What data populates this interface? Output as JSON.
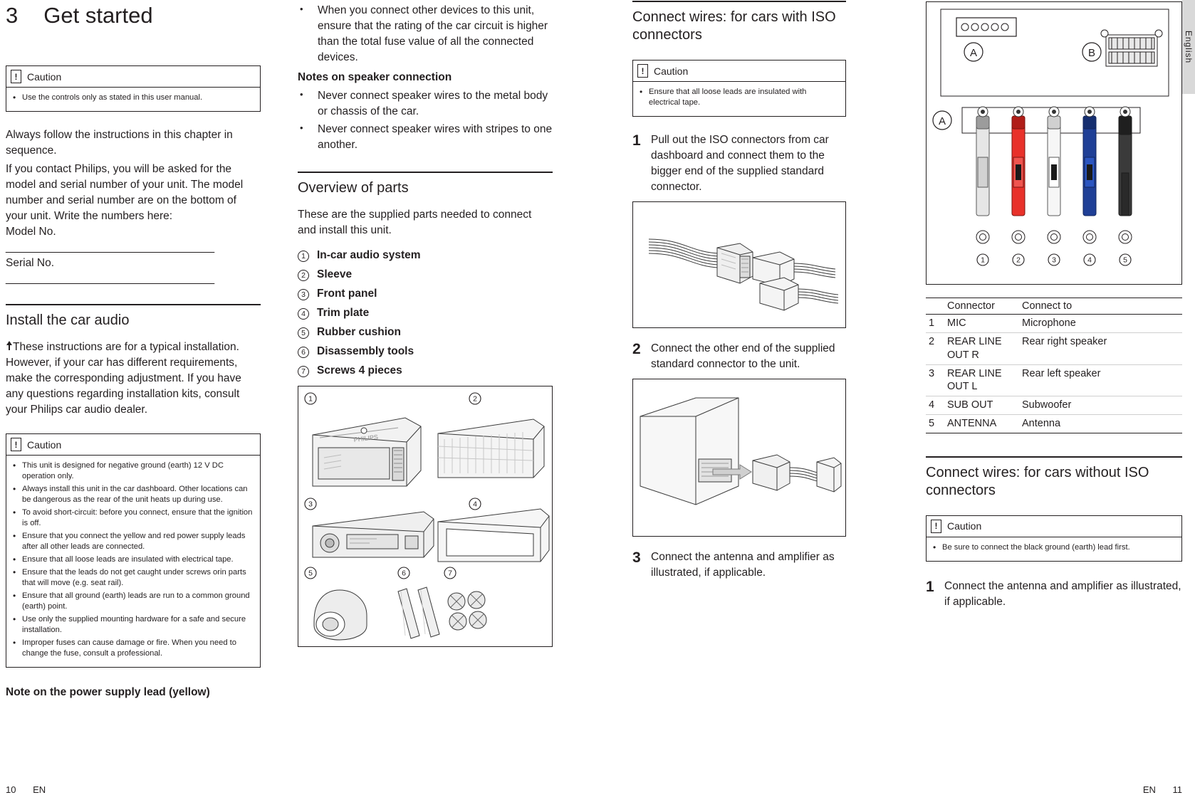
{
  "document": {
    "language_tab": "English",
    "footer_left_page": "10",
    "footer_left_lang": "EN",
    "footer_right_lang": "EN",
    "footer_right_page": "11"
  },
  "chapter": {
    "number": "3",
    "title": "Get started"
  },
  "col1": {
    "caution1": {
      "title": "Caution",
      "items": [
        "Use the controls only as stated in this user manual."
      ]
    },
    "intro_paragraphs": [
      "Always follow the instructions in this chapter in sequence.",
      "If you contact Philips, you will be asked for the model and serial number of your unit. The model number and serial number are on the bottom of your unit. Write the numbers here:",
      "Model No. __________________________________",
      "Serial No. __________________________________"
    ],
    "section_title": "Install the car audio",
    "note_paragraph": "These instructions are for a typical installation. However, if your car has different requirements, make the corresponding adjustment. If you have any questions regarding installation kits, consult your Philips car audio dealer.",
    "caution2": {
      "title": "Caution",
      "items": [
        "This unit is designed for negative ground (earth) 12 V DC operation only.",
        "Always install this unit in the car dashboard. Other locations can be dangerous as the rear of the unit heats up during use.",
        "To avoid short-circuit: before you connect, ensure that the ignition is off.",
        "Ensure that you connect the yellow and red power supply leads after all other leads are connected.",
        "Ensure that all loose leads are insulated with electrical tape.",
        "Ensure that the leads do not get caught under screws orin parts that will move (e.g. seat rail).",
        "Ensure that all ground (earth) leads are run to a common ground (earth) point.",
        "Use only the supplied mounting hardware for a safe and secure installation.",
        "Improper fuses can cause damage or fire. When you need to change the fuse, consult a professional."
      ]
    },
    "note_power_supply": "Note on the power supply lead (yellow)"
  },
  "col2": {
    "top_bullets": [
      "When you connect other devices to this unit, ensure that the rating of the car circuit is higher than the total fuse value of all the connected devices."
    ],
    "notes_heading": "Notes on speaker connection",
    "notes_bullets": [
      "Never connect speaker wires to the metal body or chassis of the car.",
      "Never connect speaker wires with stripes to one another."
    ],
    "section_title": "Overview of parts",
    "intro": "These are the supplied parts needed to connect and install this unit.",
    "parts": [
      {
        "num": "1",
        "label": "In-car audio system"
      },
      {
        "num": "2",
        "label": "Sleeve"
      },
      {
        "num": "3",
        "label": "Front panel"
      },
      {
        "num": "4",
        "label": "Trim plate"
      },
      {
        "num": "5",
        "label": "Rubber cushion"
      },
      {
        "num": "6",
        "label": "Disassembly tools"
      },
      {
        "num": "7",
        "label": "Screws 4 pieces"
      }
    ],
    "figure_labels": [
      "1",
      "2",
      "3",
      "4",
      "5",
      "6",
      "7"
    ],
    "figure_brand": "PHILIPS"
  },
  "col3": {
    "section_title": "Connect wires: for cars with ISO connectors",
    "caution": {
      "title": "Caution",
      "items": [
        "Ensure that all loose leads are insulated with electrical tape."
      ]
    },
    "steps": [
      {
        "num": "1",
        "text": "Pull out the ISO connectors from car dashboard and connect them to the bigger end of the supplied standard connector."
      },
      {
        "num": "2",
        "text": "Connect the other end of the supplied standard connector to the unit."
      },
      {
        "num": "3",
        "text": "Connect the antenna and amplifier as illustrated, if applicable."
      }
    ]
  },
  "col4": {
    "diagram_labels": {
      "a_top": "A",
      "b_top": "B",
      "a_left": "A",
      "numbers": [
        "1",
        "2",
        "3",
        "4",
        "5"
      ]
    },
    "table": {
      "headers": [
        "",
        "Connector",
        "Connect to"
      ],
      "rows": [
        {
          "idx": "1",
          "connector": "MIC",
          "connect_to": "Microphone"
        },
        {
          "idx": "2",
          "connector": "REAR LINE OUT R",
          "connect_to": "Rear right speaker"
        },
        {
          "idx": "3",
          "connector": "REAR LINE OUT L",
          "connect_to": "Rear left speaker"
        },
        {
          "idx": "4",
          "connector": "SUB OUT",
          "connect_to": "Subwoofer"
        },
        {
          "idx": "5",
          "connector": "ANTENNA",
          "connect_to": "Antenna"
        }
      ]
    },
    "section_title": "Connect wires: for cars without ISO connectors",
    "caution": {
      "title": "Caution",
      "items": [
        "Be sure to connect the black ground (earth) lead first."
      ]
    },
    "steps": [
      {
        "num": "1",
        "text": "Connect the antenna and amplifier as illustrated, if applicable."
      }
    ]
  }
}
